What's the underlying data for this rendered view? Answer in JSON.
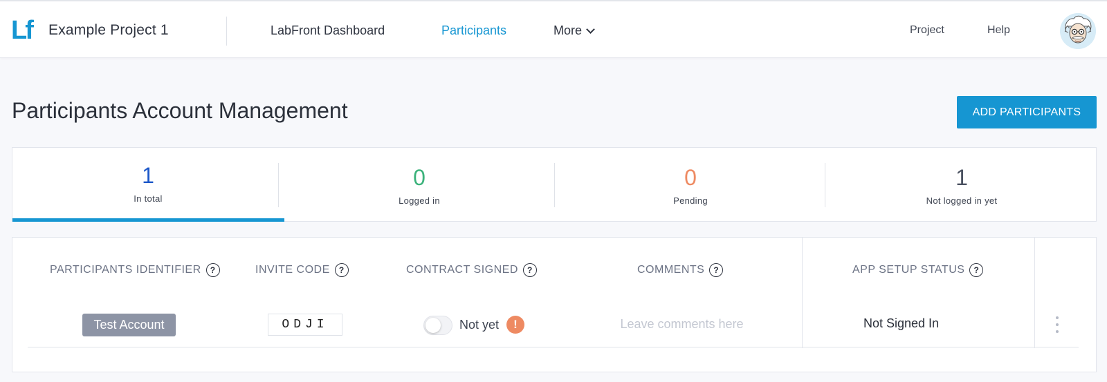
{
  "brand": {
    "logo_text": "Lf",
    "project_name": "Example Project 1"
  },
  "nav": {
    "dashboard": "LabFront Dashboard",
    "participants": "Participants",
    "more": "More",
    "project": "Project",
    "help": "Help"
  },
  "page": {
    "title": "Participants Account Management",
    "add_button": "ADD PARTICIPANTS"
  },
  "stats": [
    {
      "value": "1",
      "label": "In total"
    },
    {
      "value": "0",
      "label": "Logged in"
    },
    {
      "value": "0",
      "label": "Pending"
    },
    {
      "value": "1",
      "label": "Not logged in yet"
    }
  ],
  "table": {
    "headers": {
      "identifier": "PARTICIPANTS IDENTIFIER",
      "invite_code": "INVITE CODE",
      "contract": "CONTRACT SIGNED",
      "comments": "COMMENTS",
      "app_setup": "APP SETUP STATUS"
    },
    "help_glyph": "?",
    "rows": [
      {
        "identifier": "Test Account",
        "invite_code": "ODJI",
        "contract_status": "Not yet",
        "alert_glyph": "!",
        "comment_placeholder": "Leave comments here",
        "app_setup_status": "Not Signed In"
      }
    ]
  },
  "colors": {
    "accent": "#1696d2",
    "total": "#1d58c9",
    "logged_in": "#3bb27b",
    "pending": "#ee8a62",
    "not_logged": "#4a5160"
  }
}
